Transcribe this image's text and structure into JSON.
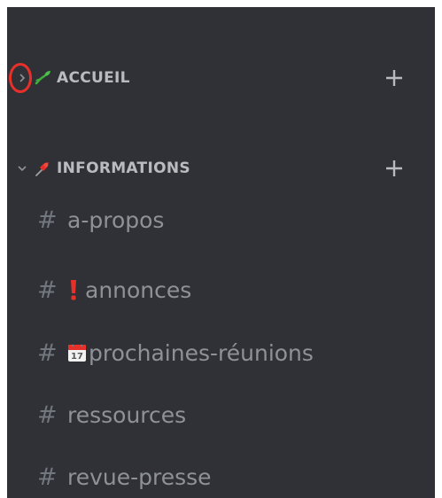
{
  "categories": [
    {
      "label": "ACCUEIL",
      "emoji": "seedling-icon",
      "collapsed": true
    },
    {
      "label": "INFORMATIONS",
      "emoji": "pushpin-icon",
      "collapsed": false
    }
  ],
  "channels": [
    {
      "label": "a-propos",
      "emoji": ""
    },
    {
      "label": "annonces",
      "emoji": "exclamation-icon"
    },
    {
      "label": "prochaines-réunions",
      "emoji": "calendar-icon"
    },
    {
      "label": "ressources",
      "emoji": ""
    },
    {
      "label": "revue-presse",
      "emoji": ""
    }
  ],
  "calendar_day": "17",
  "colors": {
    "sidebar_bg": "#2f3136",
    "category_text": "#b9bbbe",
    "channel_text": "#8e9297",
    "highlight": "#e8302a"
  }
}
